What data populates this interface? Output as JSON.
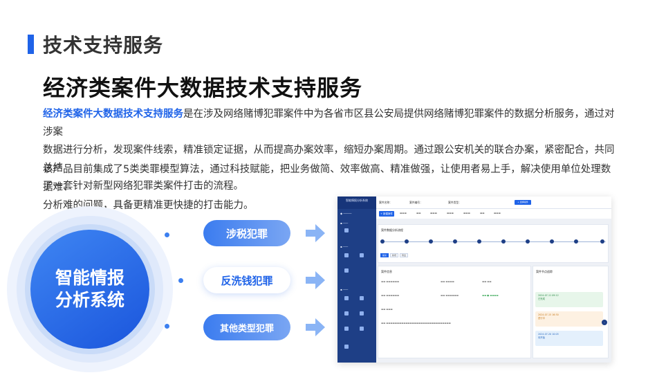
{
  "section_title": "技术支持服务",
  "main_title": "经济类案件大数据技术支持服务",
  "paragraph1": {
    "highlight": "经济类案件大数据技术支持服务",
    "line1_rest": "是在涉及网络赌博犯罪案件中为各省市区县公安局提供网络赌博犯罪案件的数据分析服务，通过对涉案",
    "line2": "数据进行分析，发现案件线索，精准锁定证据，从而提高办案效率，缩短办案周期。通过跟公安机关的联合办案，紧密配合，共同总结",
    "line3": "了一套针对新型网络犯罪类案件打击的流程。"
  },
  "paragraph2": {
    "line1": "该产品目前集成了5类类罪模型算法，通过科技赋能，把业务做简、效率做高、精准做强，让使用者易上手，解决使用单位处理数据难、",
    "line2": "分析难的问题，具备更精准更快捷的打击能力。"
  },
  "circle": {
    "line1": "智能情报",
    "line2": "分析系统"
  },
  "pills": [
    {
      "label": "涉税犯罪"
    },
    {
      "label": "反洗钱犯罪"
    },
    {
      "label": "其他类型犯罪"
    }
  ],
  "app": {
    "logo": "智能情报分析系统",
    "top": {
      "case_name": "案件名称：",
      "case_no": "案件编号：",
      "status": "案件类型：",
      "btn": "+ 选择案件"
    },
    "tab_active": "+ 新建案件",
    "panel1_title": "案件数据分析流程",
    "panel2_title": "案件信息",
    "panel3_title": "案件节点追踪",
    "mini_btns": [
      "提交",
      "新增",
      "导出"
    ],
    "cards": [
      {
        "date": "2024-07-11 09:12",
        "tag": "已完成"
      },
      {
        "date": "2024-07-15 16:30",
        "tag": "进行中"
      },
      {
        "date": "2024-07-20 10:05",
        "tag": "待开始"
      }
    ]
  },
  "colors": {
    "accent": "#1f63e8",
    "sidebar": "#1e3f86"
  }
}
